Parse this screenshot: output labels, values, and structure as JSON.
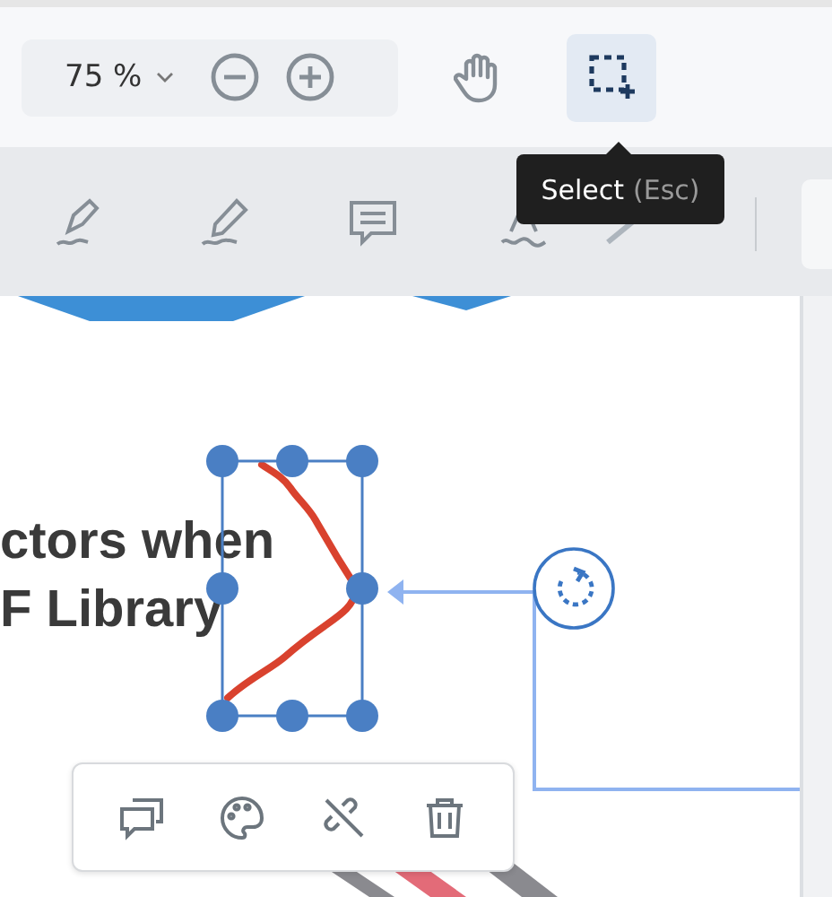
{
  "zoom": {
    "value": "75 %"
  },
  "view_tools": [
    {
      "kind": "pan",
      "selected": false
    },
    {
      "kind": "select",
      "selected": true
    }
  ],
  "tooltip": {
    "label": "Select",
    "shortcut": "(Esc)"
  },
  "annotation_tools": [
    {
      "kind": "highlight"
    },
    {
      "kind": "freehand"
    },
    {
      "kind": "comment"
    },
    {
      "kind": "squiggly"
    },
    {
      "kind": "line"
    }
  ],
  "document": {
    "lines": [
      "ctors when",
      "F Library"
    ]
  },
  "popup_tools": [
    {
      "kind": "comments"
    },
    {
      "kind": "style"
    },
    {
      "kind": "unlink"
    },
    {
      "kind": "delete"
    }
  ]
}
